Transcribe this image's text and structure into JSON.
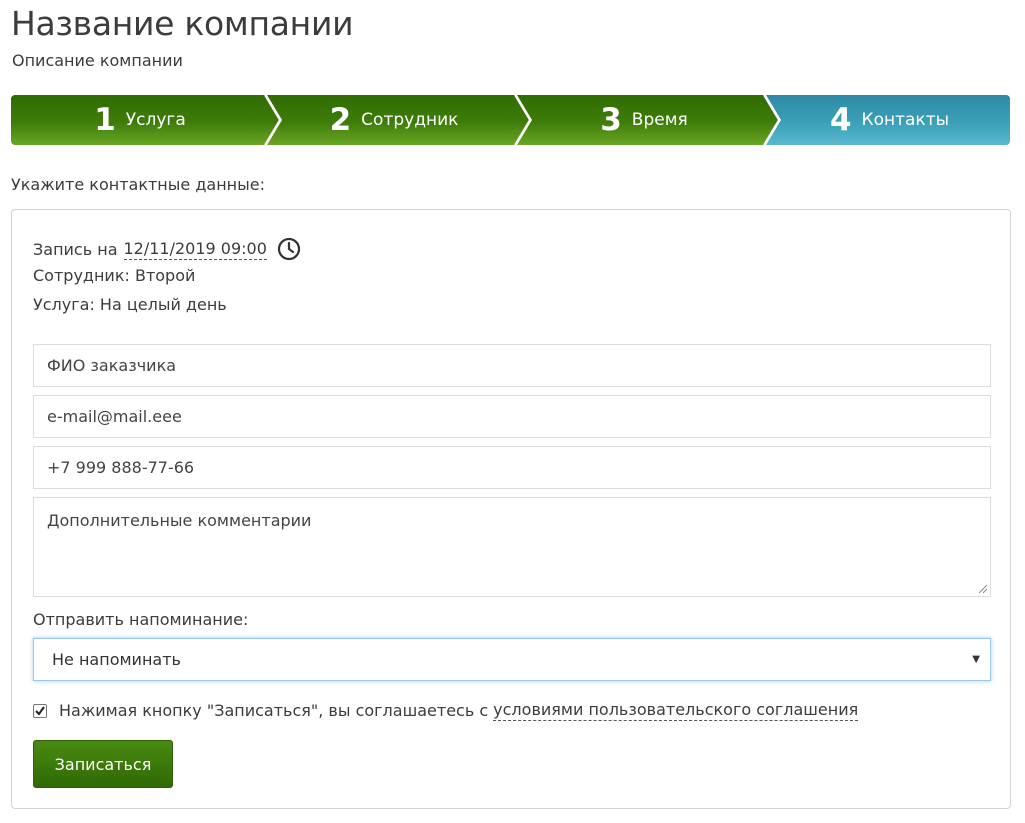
{
  "header": {
    "company_name": "Название компании",
    "company_description": "Описание компании"
  },
  "wizard": {
    "steps": [
      {
        "number": "1",
        "label": "Услуга",
        "state": "completed"
      },
      {
        "number": "2",
        "label": "Сотрудник",
        "state": "completed"
      },
      {
        "number": "3",
        "label": "Время",
        "state": "completed"
      },
      {
        "number": "4",
        "label": "Контакты",
        "state": "active"
      }
    ],
    "colors": {
      "completed": "#3f7d0a",
      "active": "#3aa0b8"
    }
  },
  "form": {
    "prompt": "Укажите контактные данные:",
    "booking": {
      "date_prefix": "Запись на",
      "datetime": "12/11/2019 09:00",
      "employee": "Сотрудник: Второй",
      "service": "Услуга: На целый день"
    },
    "fields": {
      "name_placeholder": "ФИО заказчика",
      "email_value": "e-mail@mail.eee",
      "phone_value": "+7 999 888-77-66",
      "comment_placeholder": "Дополнительные комментарии"
    },
    "reminder": {
      "label": "Отправить напоминание:",
      "selected": "Не напоминать"
    },
    "agreement": {
      "checked": true,
      "text": "Нажимая кнопку \"Записаться\", вы соглашаетесь с",
      "link": "условиями пользовательского соглашения"
    },
    "submit_label": "Записаться"
  }
}
